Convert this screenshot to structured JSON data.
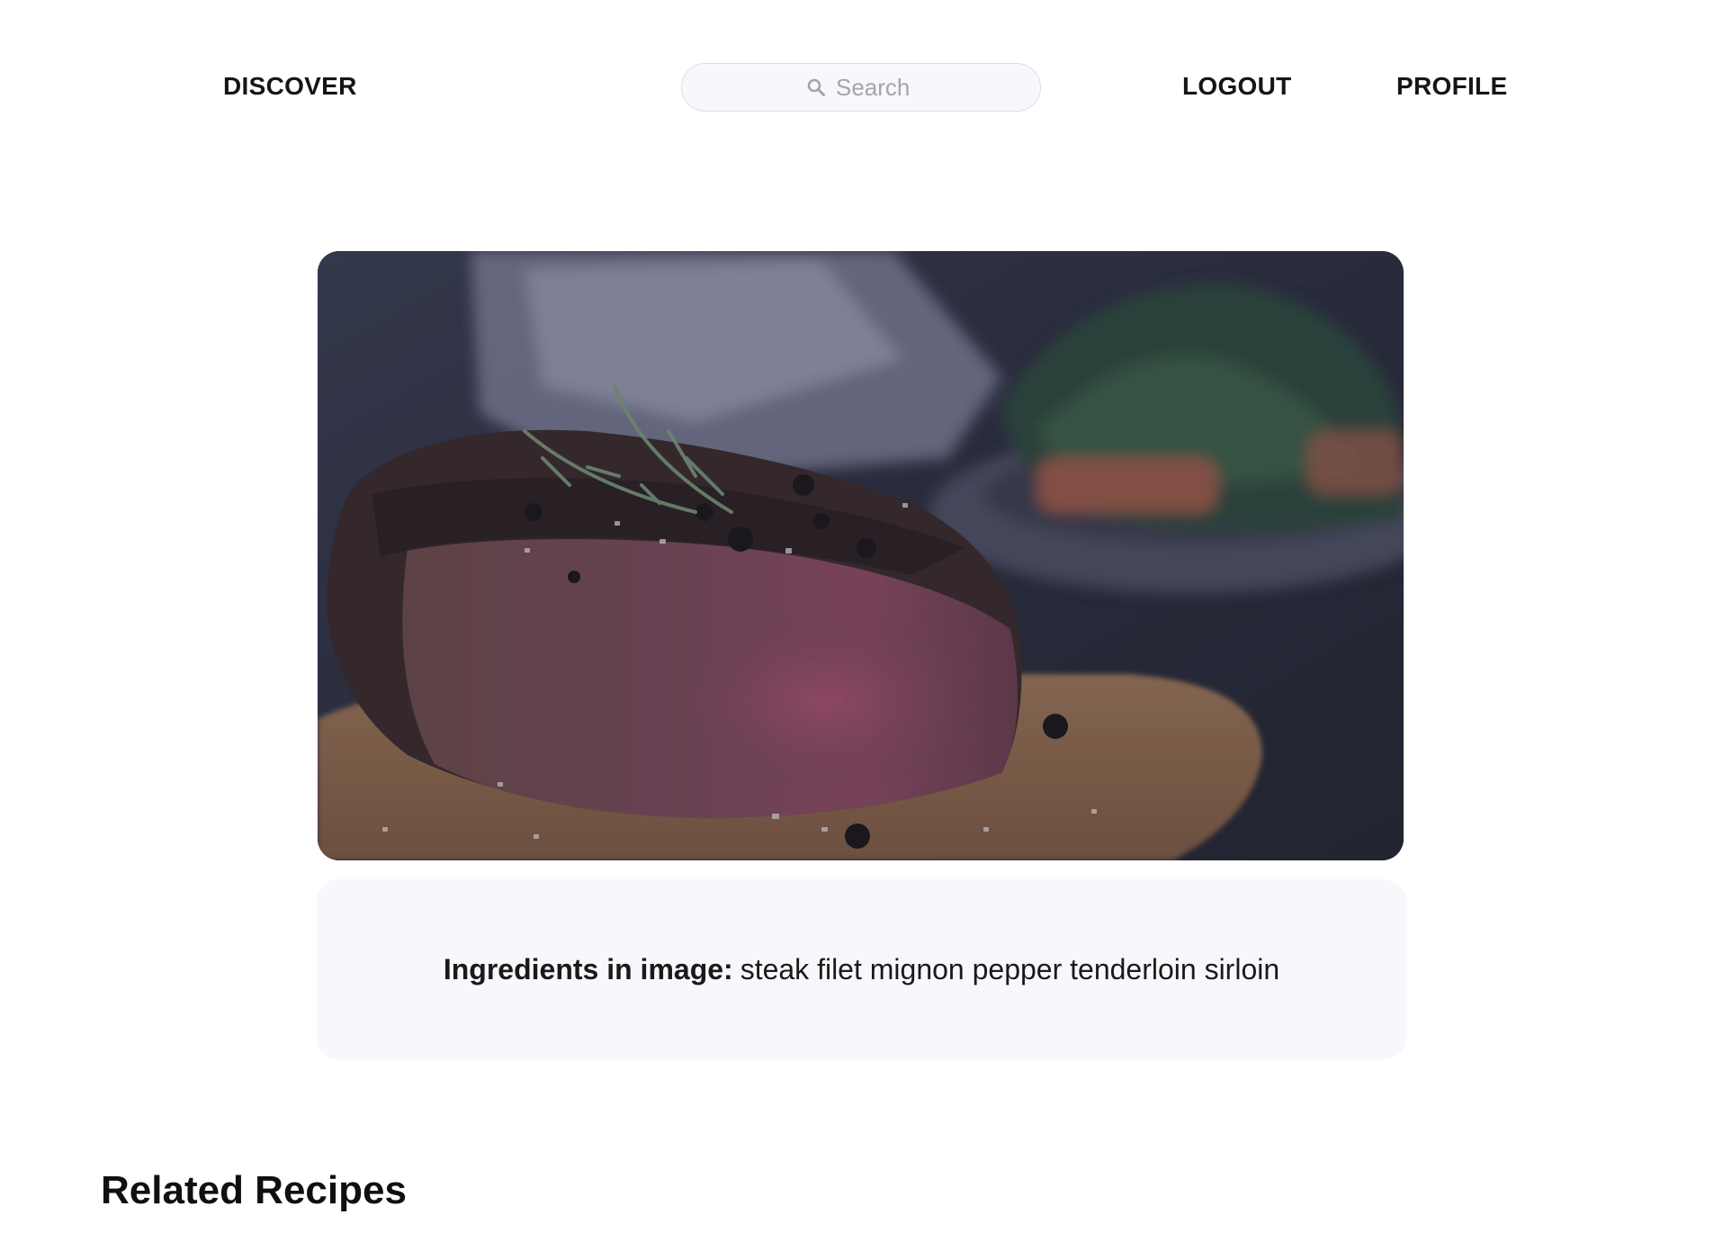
{
  "nav": {
    "discover_label": "DISCOVER",
    "logout_label": "LOGOUT",
    "profile_label": "PROFILE"
  },
  "search": {
    "placeholder": "Search",
    "icon": "search-icon"
  },
  "hero_image": {
    "subject": "steak"
  },
  "ingredients": {
    "label": "Ingredients in image:",
    "items_text": "steak filet mignon pepper tenderloin sirloin"
  },
  "related": {
    "heading": "Related Recipes"
  },
  "colors": {
    "background": "#ffffff",
    "panel": "#f7f8fc",
    "text": "#111111",
    "search_border": "#dcdce6"
  }
}
